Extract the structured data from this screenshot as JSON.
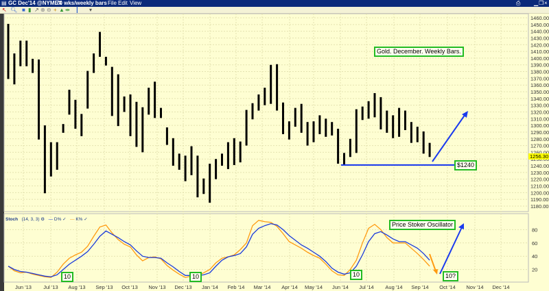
{
  "window": {
    "symbol": "GC Dec'14 @NYMEX",
    "interval": "70 wks/weekly bars",
    "menu": [
      "File",
      "Edit",
      "View"
    ],
    "controls": [
      "print-icon",
      "minimize-icon",
      "maximize-icon",
      "close-icon"
    ]
  },
  "toolbar": {
    "icons": [
      "cursor-icon",
      "zoom-icon",
      "chart-icon",
      "bar-style-icon",
      "draw-icon",
      "zoom-in-icon",
      "zoom-out-icon",
      "crosshair-icon",
      "indicator-icon",
      "split-icon",
      "pan-icon",
      "settings-icon"
    ]
  },
  "price_axis": {
    "ticks": [
      "1460.00",
      "1450.00",
      "1440.00",
      "1430.00",
      "1420.00",
      "1410.00",
      "1400.00",
      "1390.00",
      "1380.00",
      "1370.00",
      "1360.00",
      "1350.00",
      "1340.00",
      "1330.00",
      "1320.00",
      "1310.00",
      "1300.00",
      "1290.00",
      "1280.00",
      "1270.00",
      "1260.00",
      "1250.00",
      "1240.00",
      "1230.00",
      "1220.00",
      "1210.00",
      "1200.00",
      "1190.00",
      "1180.00"
    ],
    "last_price": "1256.30"
  },
  "stoch_axis": {
    "ticks": [
      "80",
      "60",
      "40",
      "20"
    ]
  },
  "stoch_header": {
    "name": "Stoch",
    "params": "(14, 3, 3)",
    "d_label": "D%",
    "k_label": "K%"
  },
  "months": [
    "Jun '13",
    "Jul '13",
    "Aug '13",
    "Sep '13",
    "Oct '13",
    "Nov '13",
    "Dec '13",
    "Jan '14",
    "Feb '14",
    "Mar '14",
    "Apr '14",
    "May '14",
    "Jun '14",
    "Jul '14",
    "Aug '14",
    "Sep '14",
    "Oct '14",
    "Nov '14",
    "Dec '14"
  ],
  "annotations": {
    "title": "Gold.  December. Weekly Bars.",
    "support": "$1240",
    "oscillator": "Price Stoker Oscillator",
    "low1": "10",
    "low2": "10",
    "low3": "10",
    "low4": "10?"
  },
  "colors": {
    "d_line": "#1a3adb",
    "k_line": "#ff9a10",
    "arrow": "#1a3aee",
    "box": "#22bb22"
  },
  "chart_data": {
    "type": "ohlc",
    "title": "Gold. December. Weekly Bars.",
    "ylim": [
      1180,
      1460
    ],
    "high": [
      1451,
      1407,
      1426,
      1426,
      1399,
      1398,
      1300,
      1275,
      1275,
      1302,
      1353,
      1338,
      1317,
      1381,
      1407,
      1439,
      1402,
      1387,
      1376,
      1343,
      1346,
      1335,
      1327,
      1356,
      1365,
      1326,
      1297,
      1281,
      1258,
      1255,
      1269,
      1255,
      1221,
      1243,
      1250,
      1258,
      1275,
      1281,
      1276,
      1323,
      1333,
      1346,
      1356,
      1390,
      1391,
      1334,
      1306,
      1326,
      1332,
      1305,
      1306,
      1315,
      1310,
      1305,
      1295,
      1259,
      1280,
      1324,
      1328,
      1336,
      1348,
      1342,
      1322,
      1315,
      1326,
      1322,
      1305,
      1298,
      1291,
      1274
    ],
    "low": [
      1369,
      1361,
      1388,
      1388,
      1378,
      1279,
      1199,
      1224,
      1234,
      1289,
      1316,
      1295,
      1284,
      1325,
      1378,
      1402,
      1389,
      1314,
      1299,
      1320,
      1284,
      1268,
      1260,
      1316,
      1311,
      1311,
      1271,
      1240,
      1234,
      1217,
      1226,
      1193,
      1198,
      1185,
      1220,
      1240,
      1235,
      1241,
      1245,
      1270,
      1309,
      1322,
      1330,
      1332,
      1322,
      1287,
      1279,
      1298,
      1289,
      1270,
      1275,
      1287,
      1283,
      1285,
      1243,
      1241,
      1253,
      1259,
      1308,
      1310,
      1312,
      1294,
      1289,
      1281,
      1283,
      1293,
      1274,
      1275,
      1258,
      1253
    ],
    "support_level": 1240,
    "stoch": {
      "ylim": [
        0,
        100
      ],
      "d": [
        25,
        20,
        17,
        16,
        14,
        12,
        10,
        9,
        12,
        20,
        28,
        34,
        40,
        47,
        58,
        70,
        78,
        73,
        68,
        62,
        57,
        48,
        40,
        38,
        38,
        37,
        30,
        24,
        17,
        11,
        11,
        11,
        12,
        15,
        25,
        34,
        39,
        41,
        44,
        54,
        73,
        82,
        86,
        89,
        87,
        80,
        71,
        64,
        57,
        52,
        46,
        40,
        32,
        22,
        16,
        13,
        15,
        25,
        42,
        62,
        74,
        77,
        72,
        66,
        62,
        62,
        57,
        52,
        44,
        34
      ],
      "k": [
        25,
        18,
        15,
        16,
        13,
        11,
        9,
        8,
        16,
        28,
        37,
        42,
        46,
        55,
        70,
        84,
        87,
        75,
        65,
        58,
        54,
        42,
        33,
        38,
        39,
        36,
        26,
        19,
        13,
        8,
        10,
        11,
        15,
        20,
        30,
        37,
        39,
        42,
        50,
        60,
        86,
        94,
        92,
        91,
        85,
        74,
        62,
        57,
        52,
        46,
        41,
        37,
        28,
        18,
        12,
        11,
        20,
        34,
        60,
        82,
        88,
        80,
        68,
        60,
        60,
        60,
        52,
        44,
        35,
        25
      ]
    }
  }
}
